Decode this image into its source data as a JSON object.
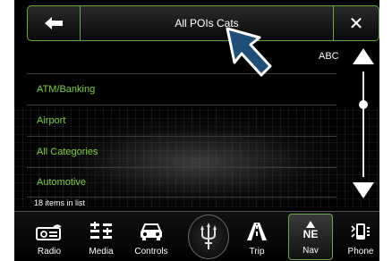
{
  "header": {
    "title": "All POIs Cats",
    "back_icon": "back-arrow-icon",
    "close_icon": "close-x-icon",
    "close_glyph": "✕"
  },
  "list": {
    "index_label": "ABC",
    "items": [
      {
        "label": "ATM/Banking"
      },
      {
        "label": "Airport"
      },
      {
        "label": "All Categories"
      },
      {
        "label": "Automotive"
      }
    ],
    "count_text": "18 items in list"
  },
  "nav": {
    "items": [
      {
        "label": "Radio",
        "icon": "radio-icon"
      },
      {
        "label": "Media",
        "icon": "media-icon"
      },
      {
        "label": "Controls",
        "icon": "car-icon"
      },
      {
        "label": "",
        "icon": "trident-logo-icon"
      },
      {
        "label": "Trip",
        "icon": "road-icon"
      },
      {
        "label": "Nav",
        "icon": "compass-icon",
        "heading": "NE",
        "active": true
      },
      {
        "label": "Phone",
        "icon": "phone-icon"
      }
    ]
  },
  "colors": {
    "accent": "#6aa93a",
    "item_text": "#7bd13d",
    "background": "#000000"
  }
}
